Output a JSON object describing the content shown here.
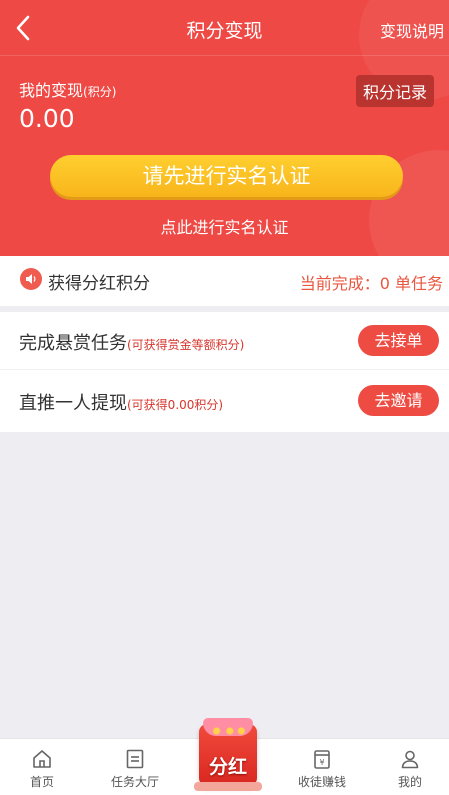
{
  "nav": {
    "title": "积分变现",
    "right": "变现说明"
  },
  "balance": {
    "label": "我的变现",
    "unit": "(积分)",
    "value": "0.00",
    "record_button": "积分记录"
  },
  "verify": {
    "button": "请先进行实名认证",
    "link": "点此进行实名认证"
  },
  "dividend": {
    "label": "获得分红积分",
    "progress_prefix": "当前完成：",
    "progress_count": "0",
    "progress_suffix": "单任务"
  },
  "tasks": [
    {
      "name": "完成悬赏任务",
      "hint": "(可获得赏金等额积分)",
      "action": "去接单"
    },
    {
      "name": "直推一人提现",
      "hint": "(可获得0.00积分)",
      "action": "去邀请"
    }
  ],
  "tabbar": {
    "home": "首页",
    "tasks": "任务大厅",
    "center": "分红",
    "apprentice": "收徒赚钱",
    "mine": "我的"
  },
  "colors": {
    "primary": "#ee4944",
    "yellow": "#fbbf22"
  },
  "icons": [
    "back-arrow-icon",
    "speaker-icon",
    "home-icon",
    "task-list-icon",
    "red-envelope-icon",
    "money-jar-icon",
    "user-icon"
  ]
}
